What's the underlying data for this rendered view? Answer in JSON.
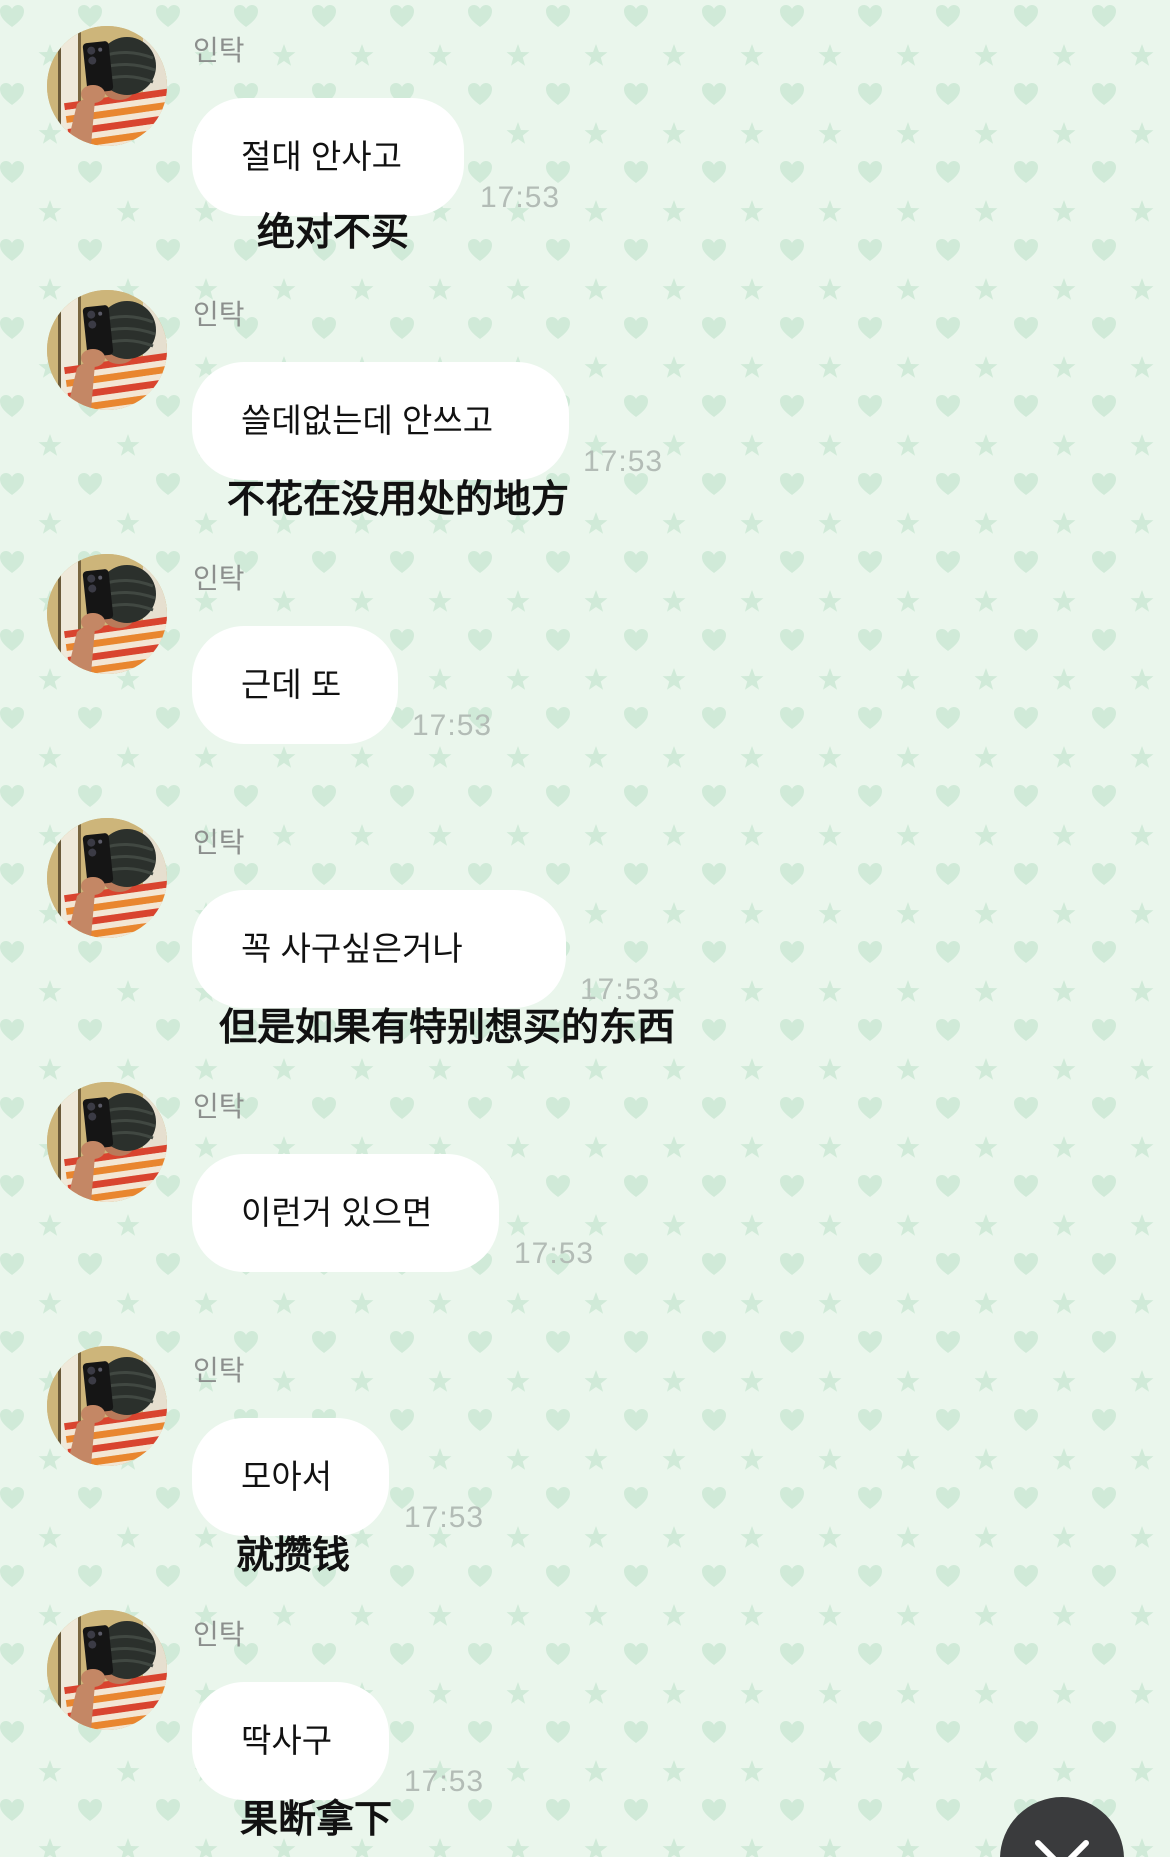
{
  "colors": {
    "background": "#eaf6ec",
    "pattern": "#d0ead8",
    "bubble": "#ffffff",
    "sender_name": "#8c8f8d",
    "time": "#b3bcb6",
    "caption": "#111111",
    "scroll_button": "#3a3b3d"
  },
  "icons": {
    "background_pattern": [
      "heart-icon",
      "star-icon"
    ],
    "scroll_button": "chevron-down-icon"
  },
  "messages": [
    {
      "sender": "인탁",
      "text": "절대 안사고",
      "time": "17:53",
      "caption": "绝对不买"
    },
    {
      "sender": "인탁",
      "text": "쓸데없는데 안쓰고",
      "time": "17:53",
      "caption": "不花在没用处的地方"
    },
    {
      "sender": "인탁",
      "text": "근데 또",
      "time": "17:53"
    },
    {
      "sender": "인탁",
      "text": "꼭 사구싶은거나",
      "time": "17:53",
      "caption": "但是如果有特别想买的东西"
    },
    {
      "sender": "인탁",
      "text": "이런거 있으면",
      "time": "17:53"
    },
    {
      "sender": "인탁",
      "text": "모아서",
      "time": "17:53",
      "caption": "就攒钱"
    },
    {
      "sender": "인탁",
      "text": "딱사구",
      "time": "17:53",
      "caption": "果断拿下"
    }
  ]
}
